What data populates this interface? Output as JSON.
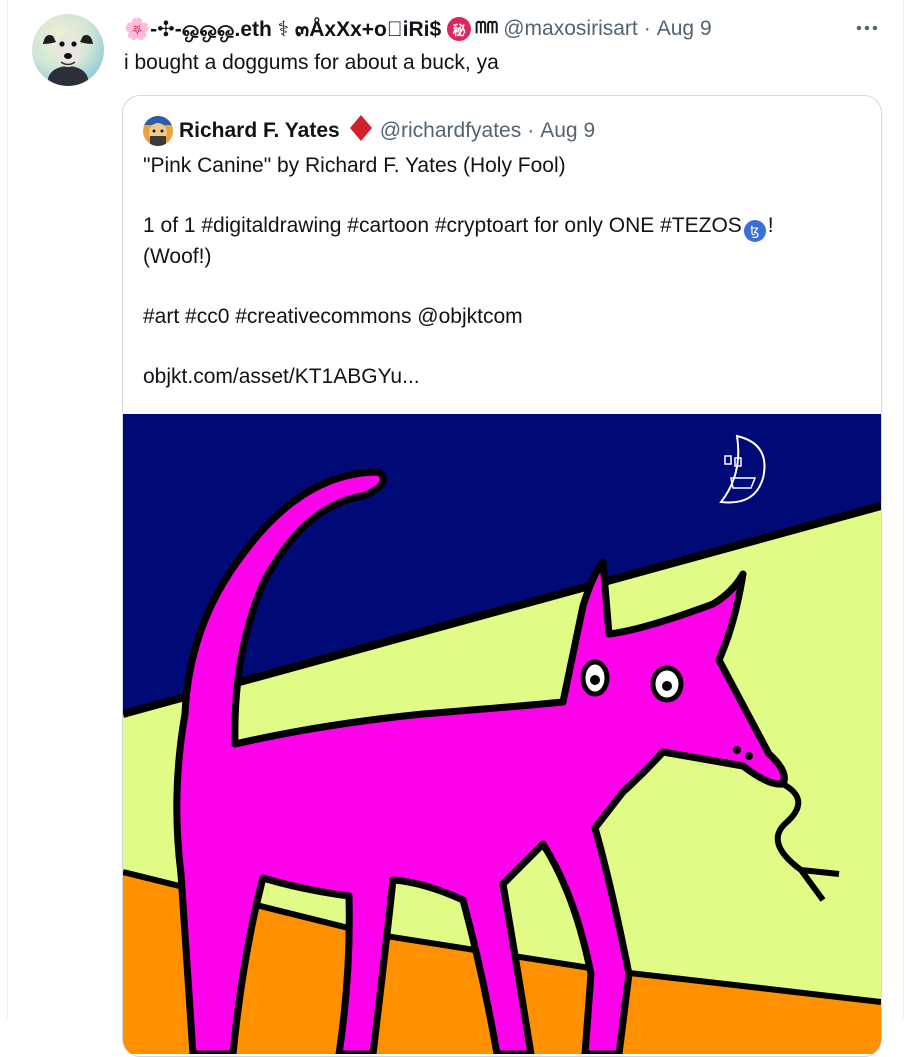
{
  "tweet": {
    "author": {
      "name": "🌸-✣-ஒஒஒ.eth ⚕ ๓ÅxXx+o⃣iRi$",
      "glyph": "ᗰᗰ",
      "badge": "秘",
      "handle": "@maxosirisart",
      "separator": "·",
      "date": "Aug 9",
      "avatar_icon": "dog-portrait-avatar"
    },
    "text": "i bought a doggums for about a buck, ya",
    "more_icon": "more-options-icon",
    "quote": {
      "author": {
        "name": "Richard F. Yates",
        "emoji": "diamond-icon",
        "handle": "@richardfyates",
        "separator": "·",
        "date": "Aug 9"
      },
      "body": {
        "line1": "\"Pink Canine\" by Richard F. Yates (Holy Fool)",
        "line2a": "1 of 1 #digitaldrawing #cartoon #cryptoart for only ONE #TEZOS",
        "tezos_symbol": "ꜩ",
        "line2b": "!",
        "line3": "(Woof!)",
        "line4": "#art #cc0 #creativecommons @objktcom",
        "line5": "objkt.com/asset/KT1ABGYu..."
      },
      "media": {
        "icon": "pink-dog-artwork",
        "colors": {
          "sky": "#000a77",
          "grass": "#e1fb87",
          "ground": "#ff9000",
          "dog": "#ff00ea"
        }
      }
    }
  }
}
